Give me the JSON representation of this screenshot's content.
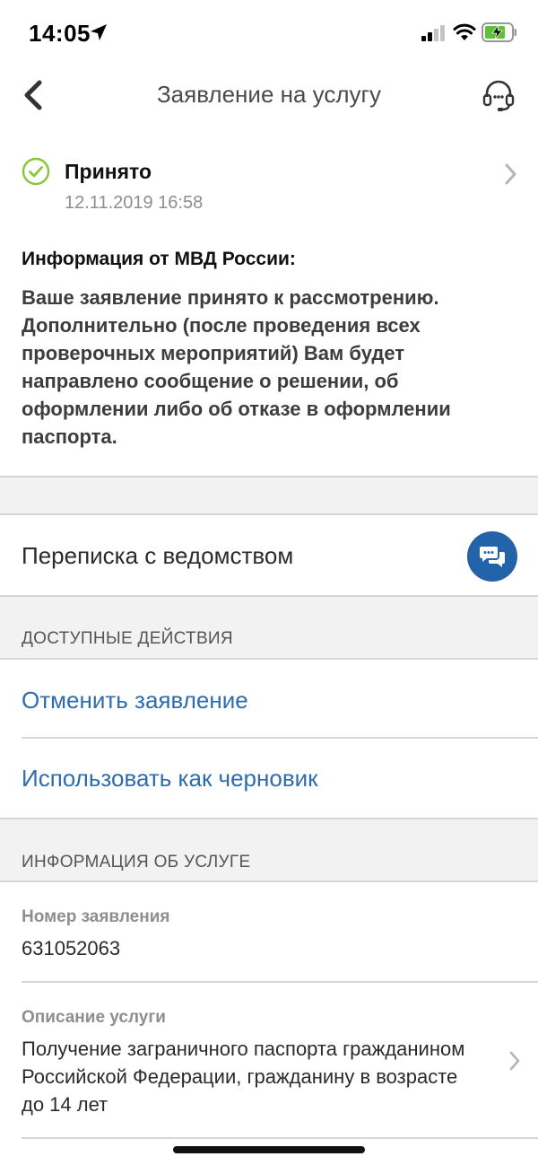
{
  "status_bar": {
    "time": "14:05",
    "icons": [
      "location-arrow-icon",
      "signal-icon",
      "wifi-icon",
      "battery-charging-icon"
    ]
  },
  "nav": {
    "title": "Заявление на услугу",
    "back_icon": "chevron-left-icon",
    "support_icon": "headset-support-icon"
  },
  "application_status": {
    "label": "Принято",
    "date": "12.11.2019 16:58",
    "color": "#8cc63f"
  },
  "info": {
    "title": "Информация от МВД России:",
    "text": "Ваше заявление принято к рассмотрению. Дополнительно (после проведения всех проверочных мероприятий) Вам будет направлено сообщение о решении, об оформлении либо об отказе в оформлении паспорта."
  },
  "correspondence": {
    "label": "Переписка с ведомством",
    "button_color": "#2363aa"
  },
  "actions": {
    "header": "ДОСТУПНЫЕ ДЕЙСТВИЯ",
    "items": [
      {
        "label": "Отменить заявление"
      },
      {
        "label": "Использовать как черновик"
      }
    ],
    "link_color": "#2d6cad"
  },
  "service_info": {
    "header": "ИНФОРМАЦИЯ ОБ УСЛУГЕ",
    "fields": [
      {
        "label": "Номер заявления",
        "value": "631052063"
      },
      {
        "label": "Описание услуги",
        "value": "Получение заграничного паспорта гражданином Российской Федерации, гражданину в возрасте до 14 лет"
      }
    ]
  }
}
